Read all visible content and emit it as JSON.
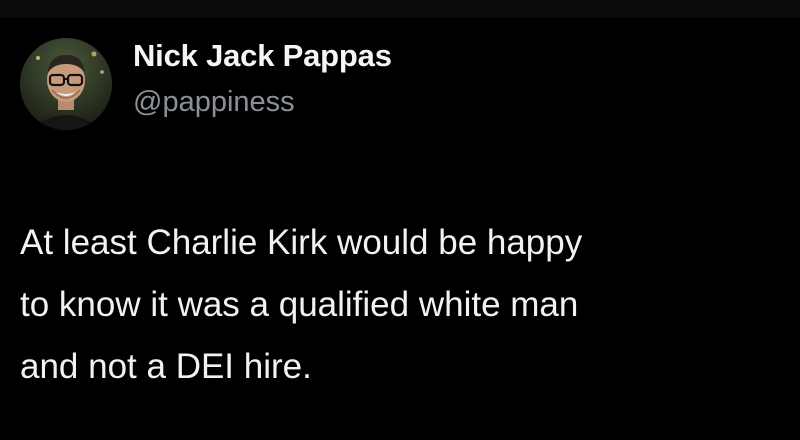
{
  "tweet": {
    "author": {
      "name": "Nick Jack Pappas",
      "handle": "@pappiness"
    },
    "text_lines": [
      "At least Charlie Kirk would be happy",
      "to know it was a qualified white man",
      "and not a DEI hire."
    ]
  },
  "colors": {
    "background": "#000000",
    "name": "#f5f5f5",
    "handle": "#8b9096",
    "body_text": "#f2f2f2"
  }
}
